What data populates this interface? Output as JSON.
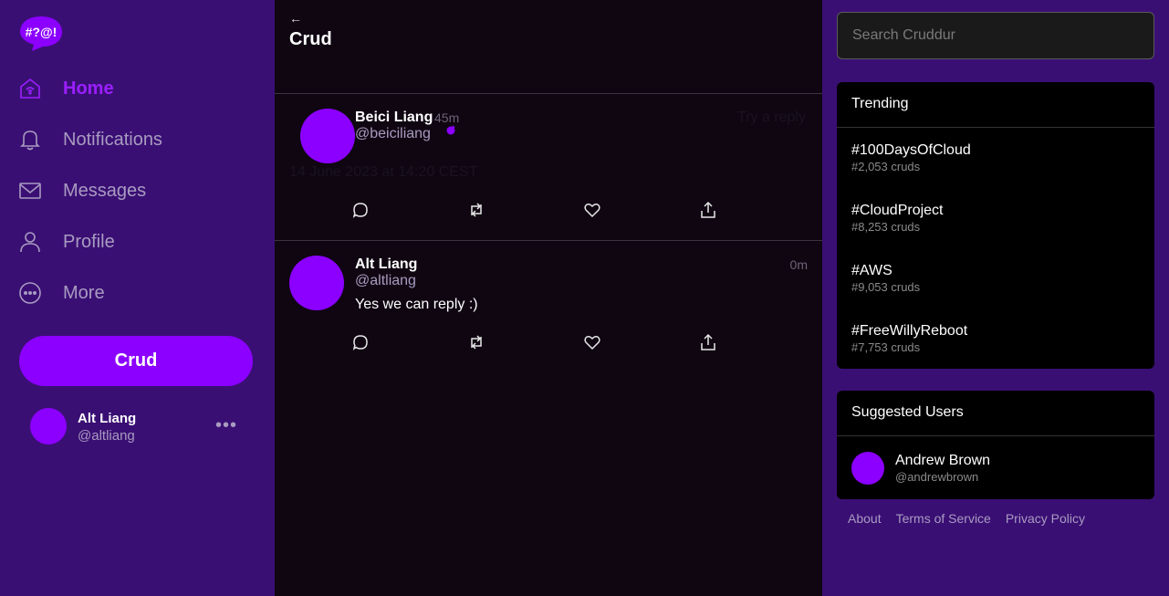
{
  "sidebar": {
    "logo_text": "#?@!",
    "nav": [
      {
        "label": "Home",
        "icon": "home-icon",
        "active": true
      },
      {
        "label": "Notifications",
        "icon": "bell-icon"
      },
      {
        "label": "Messages",
        "icon": "mail-icon"
      },
      {
        "label": "Profile",
        "icon": "user-icon"
      },
      {
        "label": "More",
        "icon": "more-circle-icon"
      }
    ],
    "crud_button": "Crud",
    "profile": {
      "name": "Alt Liang",
      "handle": "@altliang",
      "menu": "•••"
    }
  },
  "feed": {
    "back": "←",
    "title": "Crud",
    "posts": [
      {
        "name": "Beici Liang",
        "handle": "@beiciliang",
        "time": "45m",
        "reply_link": "Try a reply",
        "date": "14 June 2023 at 14:20 CEST"
      },
      {
        "name": "Alt Liang",
        "handle": "@altliang",
        "time": "0m",
        "content": "Yes we can reply :)"
      }
    ]
  },
  "right": {
    "search_placeholder": "Search Cruddur",
    "trending": {
      "title": "Trending",
      "items": [
        {
          "tag": "#100DaysOfCloud",
          "count": "#2,053 cruds"
        },
        {
          "tag": "#CloudProject",
          "count": "#8,253 cruds"
        },
        {
          "tag": "#AWS",
          "count": "#9,053 cruds"
        },
        {
          "tag": "#FreeWillyReboot",
          "count": "#7,753 cruds"
        }
      ]
    },
    "suggested": {
      "title": "Suggested Users",
      "users": [
        {
          "name": "Andrew Brown",
          "handle": "@andrewbrown"
        }
      ]
    },
    "footer": [
      "About",
      "Terms of Service",
      "Privacy Policy"
    ]
  },
  "colors": {
    "accent": "#8b00ff",
    "sidebar_bg": "#3a0f74",
    "feed_bg": "#0f0612",
    "card_bg": "#000000"
  }
}
